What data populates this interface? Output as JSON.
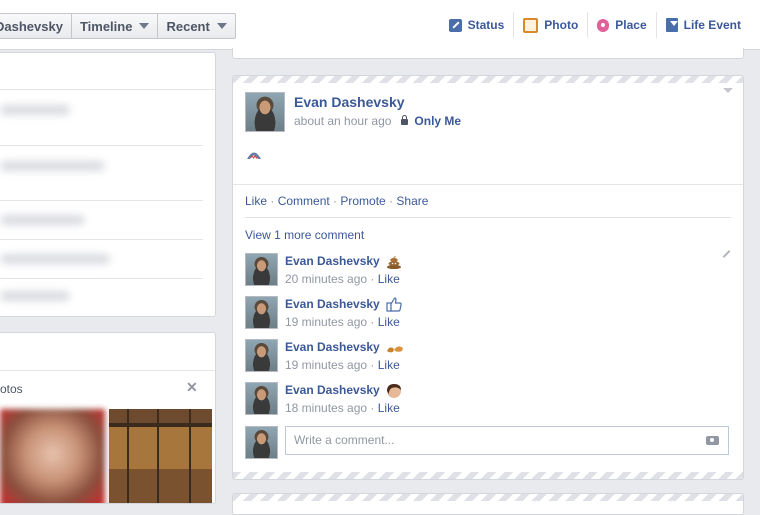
{
  "header": {
    "breadcrumbs": [
      {
        "label": "Dashevsky",
        "has_caret": false
      },
      {
        "label": "Timeline",
        "has_caret": true
      },
      {
        "label": "Recent",
        "has_caret": true
      }
    ],
    "composer": [
      {
        "label": "Status",
        "icon": "pencil-square-icon"
      },
      {
        "label": "Photo",
        "icon": "photo-icon"
      },
      {
        "label": "Place",
        "icon": "map-pin-icon"
      },
      {
        "label": "Life Event",
        "icon": "flag-icon"
      }
    ]
  },
  "left": {
    "photos_label": "otos",
    "close_glyph": "✕"
  },
  "post": {
    "author": "Evan Dashevsky",
    "timestamp": "about an hour ago",
    "privacy": "Only Me",
    "content_emoji": "shark-emoji",
    "actions": [
      "Like",
      "Comment",
      "Promote",
      "Share"
    ],
    "view_more": "View 1 more comment",
    "comments": [
      {
        "name": "Evan Dashevsky",
        "emoji": "poop-emoji",
        "time": "20 minutes ago",
        "like": "Like"
      },
      {
        "name": "Evan Dashevsky",
        "emoji": "thumbs-up-emoji",
        "time": "19 minutes ago",
        "like": "Like"
      },
      {
        "name": "Evan Dashevsky",
        "emoji": "sandals-emoji",
        "time": "19 minutes ago",
        "like": "Like"
      },
      {
        "name": "Evan Dashevsky",
        "emoji": "face-emoji",
        "time": "18 minutes ago",
        "like": "Like"
      }
    ],
    "write_placeholder": "Write a comment..."
  },
  "colors": {
    "link": "#3b5998",
    "meta": "#9197a3",
    "background": "#e9eaed"
  }
}
